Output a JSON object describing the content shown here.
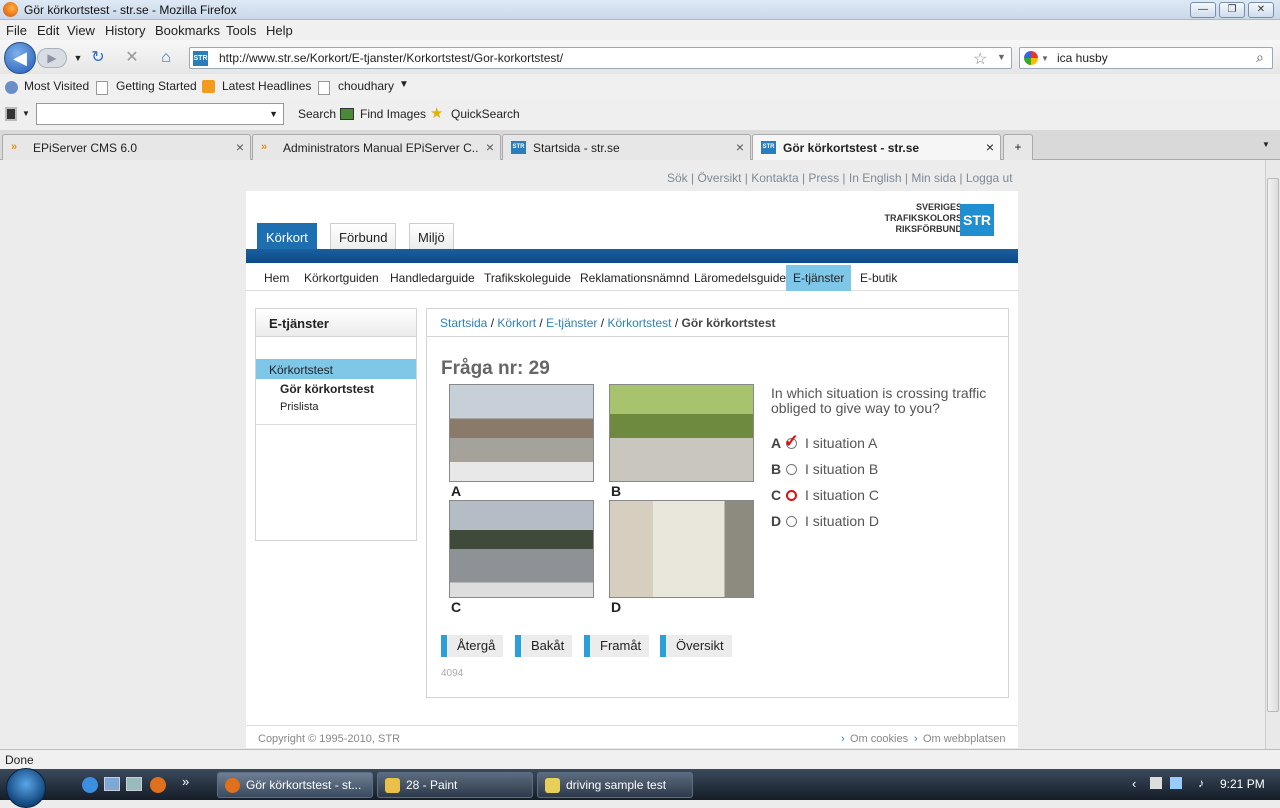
{
  "window": {
    "title": "Gör körkortstest - str.se - Mozilla Firefox"
  },
  "menu": [
    "File",
    "Edit",
    "View",
    "History",
    "Bookmarks",
    "Tools",
    "Help"
  ],
  "nav": {
    "url": "http://www.str.se/Korkort/E-tjanster/Korkortstest/Gor-korkortstest/",
    "search_value": "ica husby"
  },
  "bookmarks": [
    "Most Visited",
    "Getting Started",
    "Latest Headlines",
    "choudhary"
  ],
  "toolbar": {
    "search": "Search",
    "find_images": "Find Images",
    "quicksearch": "QuickSearch"
  },
  "tabs": [
    {
      "label": "EPiServer CMS 6.0"
    },
    {
      "label": "Administrators Manual EPiServer C..."
    },
    {
      "label": "Startsida - str.se"
    },
    {
      "label": "Gör körkortstest - str.se"
    }
  ],
  "site": {
    "toplinks": "Sök |  Översikt |  Kontakta |  Press |  In English |  Min sida  |  Logga ut",
    "logo": {
      "line1": "SVERIGES",
      "line2": "TRAFIKSKOLORS",
      "line3": "RIKSFÖRBUND",
      "badge": "STR"
    },
    "main_tabs": [
      "Körkort",
      "Förbund",
      "Miljö"
    ],
    "subnav": [
      "Hem",
      "Körkortguiden",
      "Handledarguide",
      "Trafikskoleguide",
      "Reklamationsnämnd",
      "Läromedelsguide",
      "E-tjänster",
      "E-butik"
    ],
    "left": {
      "title": "E-tjänster",
      "items": [
        "Körkortstest",
        "Gör körkortstest",
        "Prislista"
      ]
    },
    "breadcrumb": {
      "b1": "Startsida",
      "b2": "Körkort",
      "b3": "E-tjänster",
      "b4": "Körkortstest",
      "current": "Gör körkortstest"
    },
    "question": {
      "heading": "Fråga nr: 29",
      "text": "In which situation is crossing traffic obliged to give way to you?"
    },
    "images": [
      "A",
      "B",
      "C",
      "D"
    ],
    "options": [
      {
        "letter": "A",
        "label": "I situation A"
      },
      {
        "letter": "B",
        "label": "I situation B"
      },
      {
        "letter": "C",
        "label": "I situation C"
      },
      {
        "letter": "D",
        "label": "I situation D"
      }
    ],
    "buttons": [
      "Återgå",
      "Bakåt",
      "Framåt",
      "Översikt"
    ],
    "code": "4094",
    "footer": {
      "copyright": "Copyright © 1995-2010, STR",
      "cookies": "Om cookies",
      "about": "Om webbplatsen"
    }
  },
  "status": "Done",
  "taskbar": {
    "items": [
      "Gör körkortstest - st...",
      "28 - Paint",
      "driving sample test"
    ],
    "clock": "9:21 PM"
  }
}
